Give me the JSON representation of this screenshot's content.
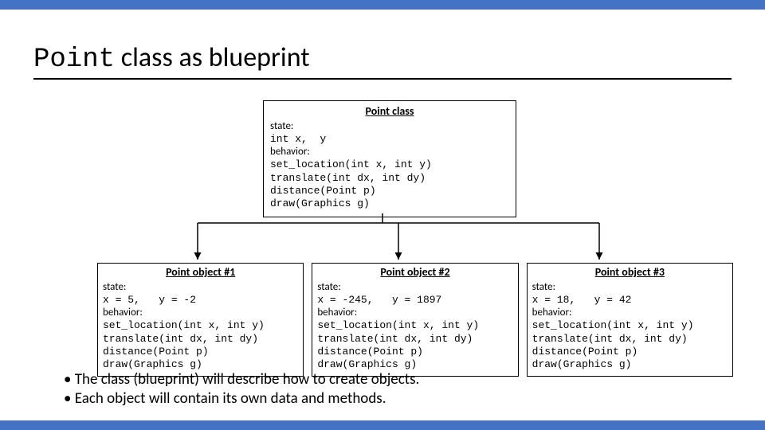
{
  "title": {
    "mono": "Point",
    "rest": " class as blueprint"
  },
  "class_box": {
    "title": "Point class",
    "state_label": "state:",
    "state_code": "int x,  y",
    "behavior_label": "behavior:",
    "behaviors": [
      "set_location(int x, int y)",
      "translate(int dx, int dy)",
      "distance(Point p)",
      "draw(Graphics g)"
    ]
  },
  "objects": [
    {
      "title": "Point object #1",
      "state_label": "state:",
      "state_code": "x = 5,   y = -2",
      "behavior_label": "behavior:",
      "behaviors": [
        "set_location(int x, int y)",
        "translate(int dx, int dy)",
        "distance(Point p)",
        "draw(Graphics g)"
      ]
    },
    {
      "title": "Point object #2",
      "state_label": "state:",
      "state_code": "x = -245,   y = 1897",
      "behavior_label": "behavior:",
      "behaviors": [
        "set_location(int x, int y)",
        "translate(int dx, int dy)",
        "distance(Point p)",
        "draw(Graphics g)"
      ]
    },
    {
      "title": "Point object #3",
      "state_label": "state:",
      "state_code": "x = 18,   y = 42",
      "behavior_label": "behavior:",
      "behaviors": [
        "set_location(int x, int y)",
        "translate(int dx, int dy)",
        "distance(Point p)",
        "draw(Graphics g)"
      ]
    }
  ],
  "bullets": [
    "The class (blueprint) will describe how to create objects.",
    "Each object will contain its own data and methods."
  ]
}
